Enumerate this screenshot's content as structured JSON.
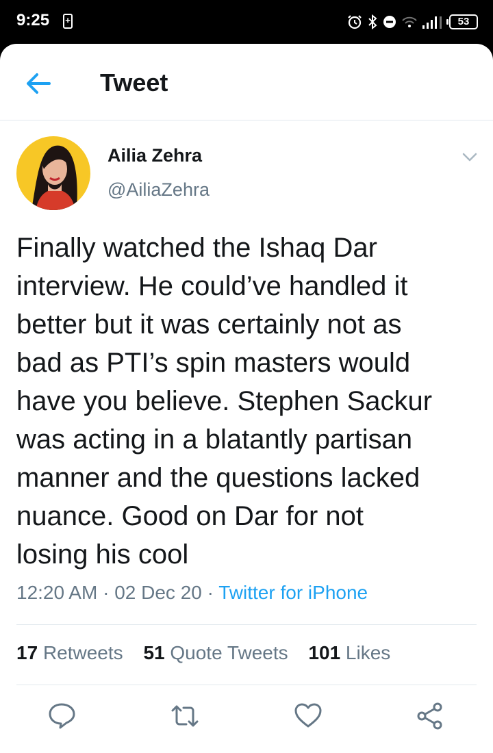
{
  "status_bar": {
    "time": "9:25",
    "battery_level": "53"
  },
  "header": {
    "title": "Tweet"
  },
  "tweet": {
    "author_name": "Ailia Zehra",
    "author_handle": "@AiliaZehra",
    "text": "Finally watched the Ishaq Dar\ninterview. He could’ve handled it\nbetter but it was certainly not as\nbad as PTI’s spin masters would\nhave you believe. Stephen Sackur\nwas acting in a blatantly partisan\nmanner and the questions lacked\nnuance. Good on Dar for not\nlosing his cool",
    "time": "12:20 AM",
    "date": "02 Dec 20",
    "separator": " · ",
    "source": "Twitter for iPhone"
  },
  "stats": {
    "retweets_count": "17",
    "retweets_label": "Retweets",
    "quote_count": "51",
    "quote_label": "Quote Tweets",
    "likes_count": "101",
    "likes_label": "Likes"
  },
  "colors": {
    "accent": "#1da1f2",
    "text_primary": "#14171a",
    "text_secondary": "#657786",
    "divider": "#e1e8ed"
  },
  "icons": {
    "back": "arrow-left-icon",
    "caret": "chevron-down-icon",
    "reply": "comment-icon",
    "retweet": "retweet-icon",
    "like": "heart-icon",
    "share": "share-icon"
  }
}
